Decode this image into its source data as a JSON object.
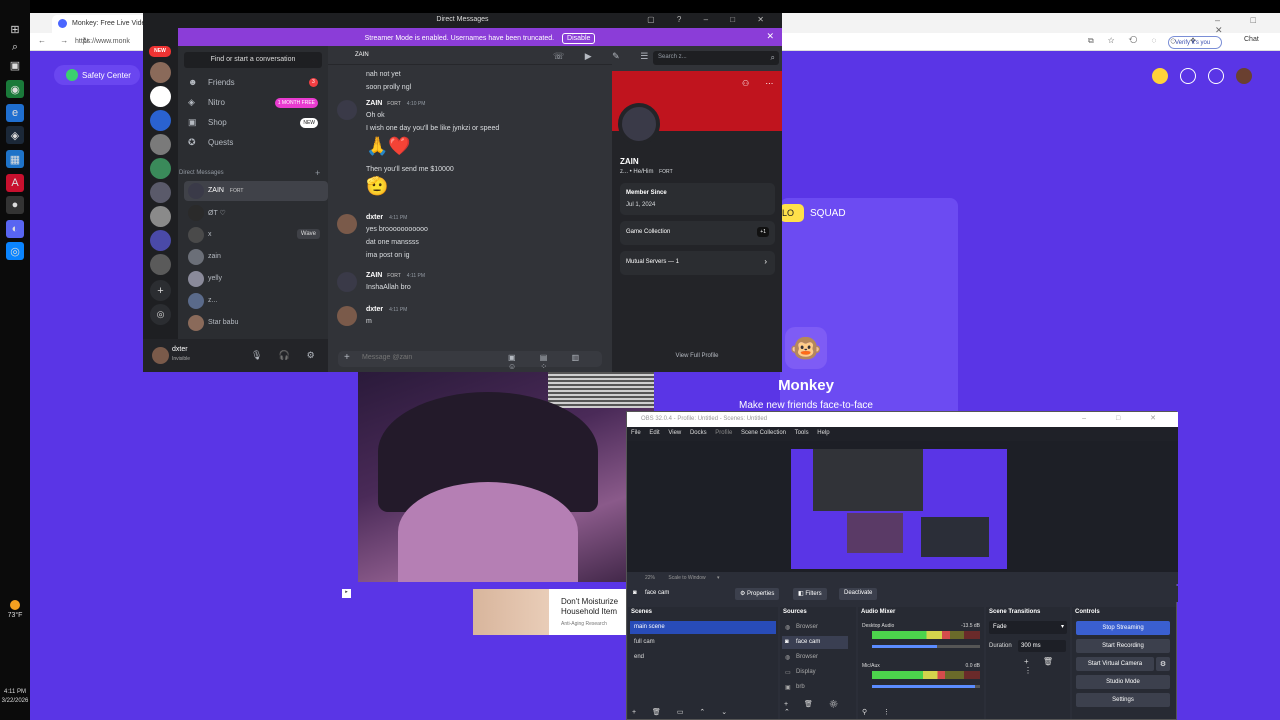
{
  "taskbar": {
    "temp": "73°F",
    "time": "4:11 PM",
    "date": "3/22/2026"
  },
  "browser": {
    "tab_title": "Monkey: Free Live Video...",
    "url": "https://www.monk",
    "verify_label": "Verify it's you",
    "chat_label": "Chat"
  },
  "monkey": {
    "safety_center": "Safety Center",
    "solo_label": "LO",
    "squad_label": "SQUAD",
    "title": "Monkey",
    "subtitle": "Make new friends face-to-face"
  },
  "ad": {
    "title": "Don't Moisturize Household Item",
    "source": "Anti-Aging Research"
  },
  "discord": {
    "window_title": "Direct Messages",
    "banner_text": "Streamer Mode is enabled. Usernames have been truncated.",
    "banner_button": "Disable",
    "new_badge": "NEW",
    "find_placeholder": "Find or start a conversation",
    "nav": [
      {
        "label": "Friends",
        "badge": "3"
      },
      {
        "label": "Nitro",
        "badge": "1 MONTH FREE"
      },
      {
        "label": "Shop",
        "badge": "NEW"
      },
      {
        "label": "Quests",
        "badge": ""
      }
    ],
    "dm_header": "Direct Messages",
    "dms": [
      {
        "name": "ZAIN",
        "tag": "FORT"
      },
      {
        "name": "ØT ♡",
        "tag": ""
      },
      {
        "name": "x",
        "tag": "",
        "wave": "Wave"
      },
      {
        "name": "zain",
        "tag": ""
      },
      {
        "name": "yelly",
        "tag": ""
      },
      {
        "name": "z...",
        "tag": ""
      },
      {
        "name": "Star babu",
        "tag": ""
      }
    ],
    "user": {
      "name": "dxter",
      "status": "Invisible"
    },
    "chat_header": "ZAIN",
    "search_placeholder": "Search z...",
    "messages": [
      {
        "lines": [
          "nah not yet",
          "soon prolly ngl"
        ]
      },
      {
        "name": "ZAIN",
        "tag": "FORT",
        "time": "4:10 PM",
        "lines": [
          "Oh ok",
          "I wish one day you'll be like jynkzi or speed"
        ]
      },
      {
        "emoji": "🙏❤️"
      },
      {
        "lines": [
          "Then you'll send me $10000"
        ]
      },
      {
        "emoji": "🫡"
      },
      {
        "name": "dxter",
        "time": "4:11 PM",
        "lines": [
          "yes brooooooooooo",
          "dat one manssss",
          "ima post on ig"
        ]
      },
      {
        "name": "ZAIN",
        "tag": "FORT",
        "time": "4:11 PM",
        "lines": [
          "InshaAllah bro"
        ]
      },
      {
        "name": "dxter",
        "time": "4:11 PM",
        "lines": [
          "m"
        ]
      }
    ],
    "input_placeholder": "Message @zain",
    "profile": {
      "name": "ZAIN",
      "pronouns": "z... • He/Him",
      "tag": "FORT",
      "member_since_label": "Member Since",
      "member_since": "Jul 1, 2024",
      "game_collection": "Game Collection",
      "game_more": "+1",
      "mutual_servers": "Mutual Servers — 1",
      "view_full": "View Full Profile"
    }
  },
  "obs": {
    "title": "OBS 32.0.4 - Profile: Untitled - Scenes: Untitled",
    "menu": [
      "File",
      "Edit",
      "View",
      "Docks",
      "Profile",
      "Scene Collection",
      "Tools",
      "Help"
    ],
    "zoom": "22%",
    "zoom_mode": "Scale to Window",
    "source_name": "face cam",
    "properties": "Properties",
    "filters": "Filters",
    "deactivate": "Deactivate",
    "scenes_header": "Scenes",
    "scenes": [
      "main scene",
      "full cam",
      "end"
    ],
    "sources_header": "Sources",
    "sources": [
      "Browser",
      "face cam",
      "Browser",
      "Display",
      "brb"
    ],
    "mixer_header": "Audio Mixer",
    "mixer": [
      {
        "name": "Desktop Audio",
        "db": "-13.5 dB",
        "level": 0.72,
        "volume": 0.6
      },
      {
        "name": "Mic/Aux",
        "db": "0.0 dB",
        "level": 0.68,
        "volume": 0.95
      }
    ],
    "transitions_header": "Scene Transitions",
    "transition": "Fade",
    "duration_label": "Duration",
    "duration": "300 ms",
    "controls_header": "Controls",
    "controls": [
      "Stop Streaming",
      "Start Recording",
      "Start Virtual Camera",
      "Studio Mode",
      "Settings"
    ]
  }
}
